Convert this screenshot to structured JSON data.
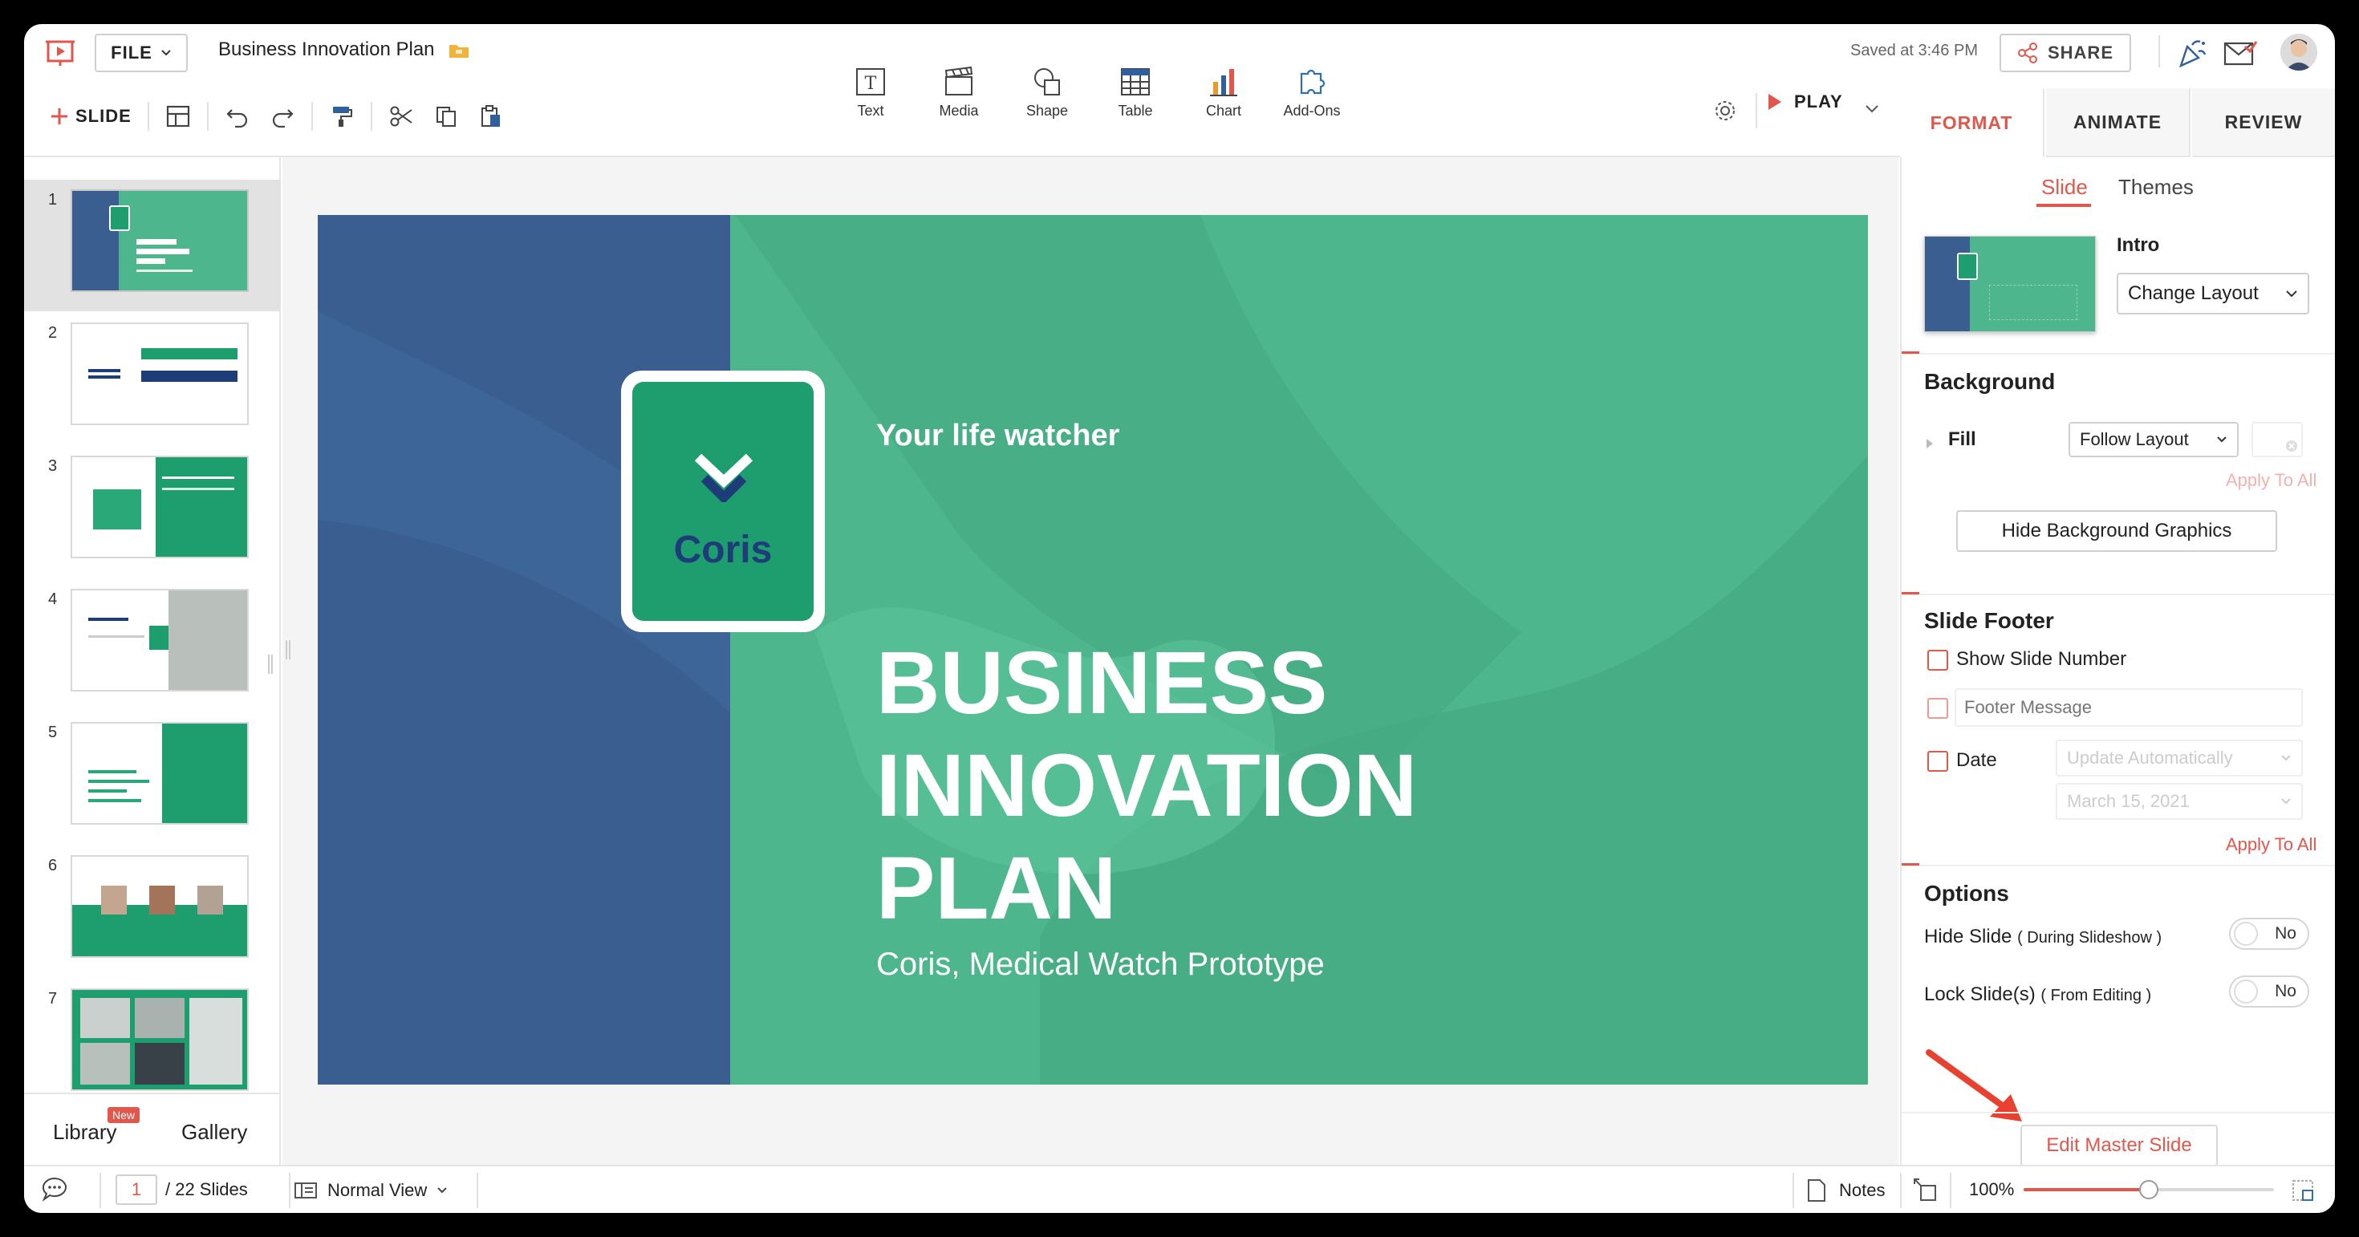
{
  "header": {
    "file_label": "FILE",
    "doc_title": "Business Innovation Plan",
    "saved": "Saved at 3:46 PM",
    "share_label": "SHARE",
    "new_slide_label": "SLIDE",
    "play_label": "PLAY"
  },
  "insert": [
    {
      "label": "Text",
      "icon": "text-box-icon"
    },
    {
      "label": "Media",
      "icon": "media-clapper-icon"
    },
    {
      "label": "Shape",
      "icon": "shape-icon"
    },
    {
      "label": "Table",
      "icon": "table-icon"
    },
    {
      "label": "Chart",
      "icon": "bar-chart-icon"
    },
    {
      "label": "Add-Ons",
      "icon": "puzzle-icon"
    }
  ],
  "panel_tabs": {
    "format": "FORMAT",
    "animate": "ANIMATE",
    "review": "REVIEW"
  },
  "thumbs": [
    {
      "num": "1"
    },
    {
      "num": "2"
    },
    {
      "num": "3"
    },
    {
      "num": "4"
    },
    {
      "num": "5"
    },
    {
      "num": "6"
    },
    {
      "num": "7"
    }
  ],
  "sidebar_footer": {
    "library": "Library",
    "new_badge": "New",
    "gallery": "Gallery"
  },
  "slide": {
    "tagline": "Your life watcher",
    "brand": "Coris",
    "title_line1": "BUSINESS",
    "title_line2": "INNOVATION",
    "title_line3": "PLAN",
    "subtitle": "Coris, Medical Watch Prototype"
  },
  "format": {
    "sub_tab_slide": "Slide",
    "sub_tab_themes": "Themes",
    "layout_name": "Intro",
    "change_layout": "Change Layout",
    "background_title": "Background",
    "fill_label": "Fill",
    "fill_value": "Follow Layout",
    "apply_to_all_1": "Apply To All",
    "hide_bg_graphics": "Hide Background Graphics",
    "footer_title": "Slide Footer",
    "show_slide_number": "Show Slide Number",
    "footer_placeholder": "Footer Message",
    "date_label": "Date",
    "date_mode": "Update Automatically",
    "date_value": "March 15, 2021",
    "apply_to_all_2": "Apply To All",
    "options_title": "Options",
    "hide_slide": "Hide Slide",
    "hide_slide_note": "( During Slideshow )",
    "hide_slide_value": "No",
    "lock_slide": "Lock Slide(s)",
    "lock_slide_note": "( From Editing )",
    "lock_slide_value": "No",
    "edit_master": "Edit Master Slide"
  },
  "status": {
    "current_page": "1",
    "total": "/ 22 Slides",
    "view": "Normal View",
    "notes": "Notes",
    "zoom": "100%",
    "zoom_level": 0.5
  },
  "colors": {
    "accent": "#e2574c",
    "slide_green": "#4eb68c",
    "slide_blue": "#3a5e8f",
    "brand_green": "#1e9e6e",
    "navy": "#1d3c78"
  }
}
